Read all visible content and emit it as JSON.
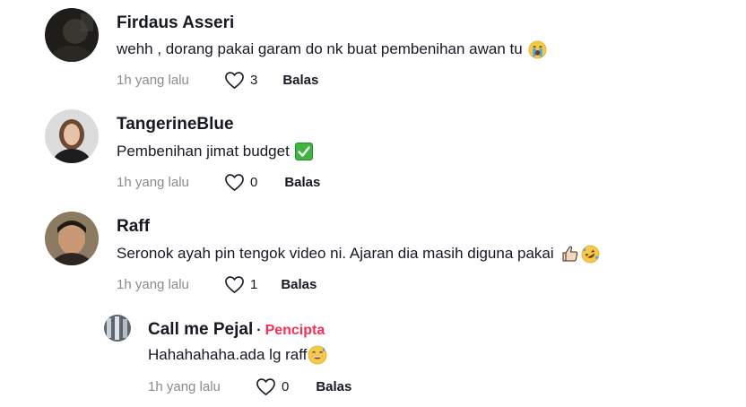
{
  "comments": [
    {
      "author": "Firdaus Asseri",
      "text": "wehh , dorang pakai garam do nk buat pembenihan awan tu",
      "emoji": "loudly-crying-face-icon",
      "time": "1h yang lalu",
      "likes": "3",
      "reply_label": "Balas"
    },
    {
      "author": "TangerineBlue",
      "text": "Pembenihan jimat budget",
      "emoji": "check-mark-button-icon",
      "time": "1h yang lalu",
      "likes": "0",
      "reply_label": "Balas"
    },
    {
      "author": "Raff",
      "text": "Seronok ayah pin tengok video ni. Ajaran dia masih diguna pakai",
      "emoji": "thumbs-up-icon, rolling-on-floor-laughing-icon",
      "time": "1h yang lalu",
      "likes": "1",
      "reply_label": "Balas"
    }
  ],
  "reply": {
    "author": "Call me Pejal",
    "separator": "·",
    "badge": "Pencipta",
    "text": "Hahahahaha.ada lg raff",
    "emoji": "grinning-sweat-face-icon",
    "time": "1h yang lalu",
    "likes": "0",
    "reply_label": "Balas"
  },
  "colors": {
    "text": "#161823",
    "muted": "#8a8b91",
    "creator_badge": "#fe2c55"
  }
}
